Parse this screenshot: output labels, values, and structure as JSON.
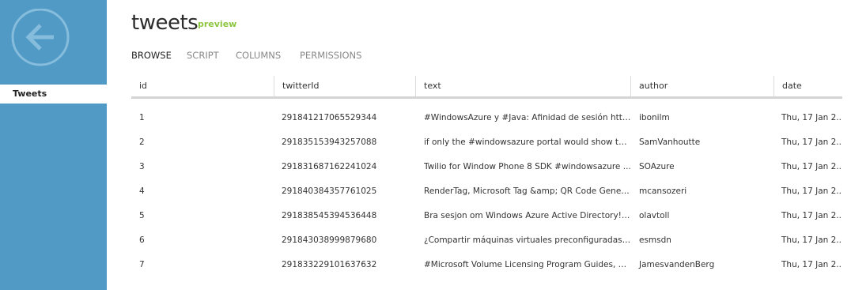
{
  "sidebar": {
    "back_icon": "back-arrow-icon",
    "items": [
      {
        "label": "Tweets"
      }
    ]
  },
  "header": {
    "title": "tweets",
    "badge": "preview"
  },
  "tabs": [
    {
      "label": "BROWSE"
    },
    {
      "label": "SCRIPT"
    },
    {
      "label": "COLUMNS"
    },
    {
      "label": "PERMISSIONS"
    }
  ],
  "table": {
    "columns": [
      "id",
      "twitterId",
      "text",
      "author",
      "date"
    ],
    "rows": [
      [
        "1",
        "291841217065529344",
        "#WindowsAzure y #Java: Afinidad de sesión http...",
        "ibonilm",
        "Thu, 17 Jan 2..."
      ],
      [
        "2",
        "291835153943257088",
        "if only the #windowsazure portal would show th...",
        "SamVanhoutte",
        "Thu, 17 Jan 2..."
      ],
      [
        "3",
        "291831687162241024",
        "Twilio for Window Phone 8 SDK #windowsazure ...",
        "SOAzure",
        "Thu, 17 Jan 2..."
      ],
      [
        "4",
        "291840384357761025",
        "RenderTag, Microsoft Tag &amp; QR Code Gener...",
        "mcansozeri",
        "Thu, 17 Jan 2..."
      ],
      [
        "5",
        "291838545394536448",
        "Bra sesjon om Windows Azure Active Directory! ...",
        "olavtoll",
        "Thu, 17 Jan 2..."
      ],
      [
        "6",
        "291843038999879680",
        "¿Compartir máquinas virtuales preconfiguradas d...",
        "esmsdn",
        "Thu, 17 Jan 2..."
      ],
      [
        "7",
        "291833229101637632",
        "#Microsoft Volume Licensing Program Guides, D...",
        "JamesvandenBerg",
        "Thu, 17 Jan 2..."
      ]
    ]
  },
  "colors": {
    "sidebar": "#519ac6",
    "preview": "#8dc63f"
  }
}
